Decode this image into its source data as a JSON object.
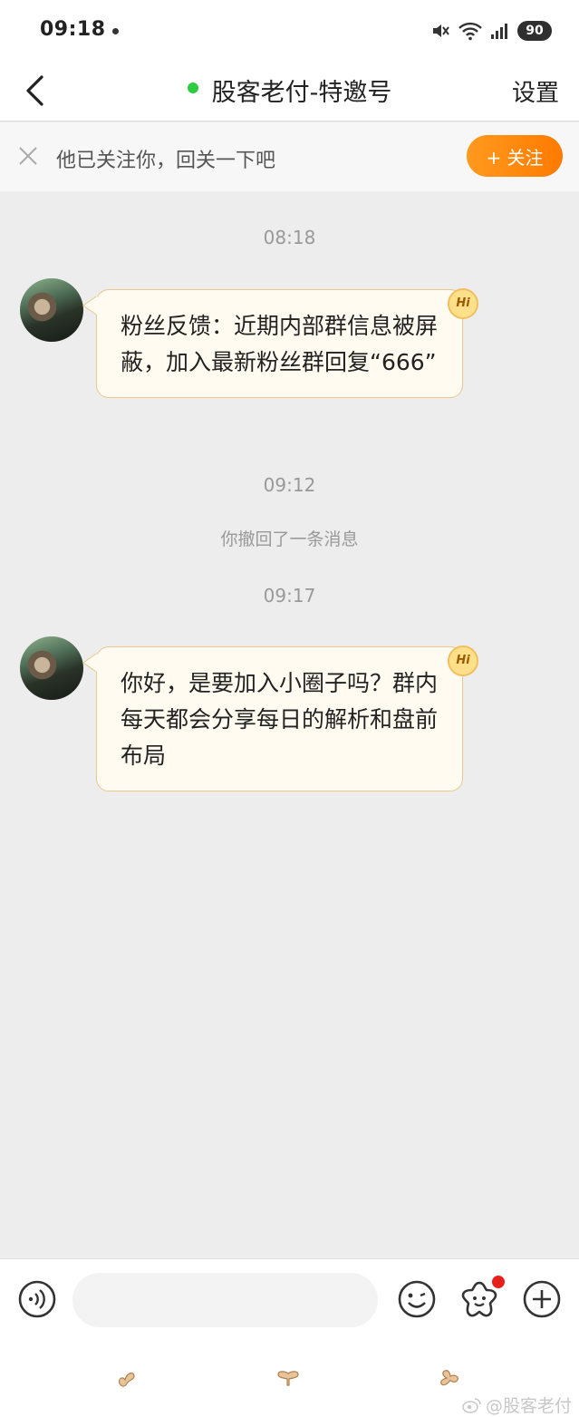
{
  "status_bar": {
    "time": "09:18",
    "battery": "90"
  },
  "nav": {
    "title": "股客老付-特邀号",
    "settings_label": "设置",
    "online_color": "#2ecc40"
  },
  "banner": {
    "text": "他已关注你，回关一下吧",
    "follow_label": "+ 关注",
    "accent": "#ff8a10"
  },
  "messages": [
    {
      "type": "timestamp",
      "text": "08:18"
    },
    {
      "type": "bubble",
      "text": "粉丝反馈：近期内部群信息被屏蔽，加入最新粉丝群回复“666”",
      "badge": "Hi"
    },
    {
      "type": "timestamp",
      "text": "09:12"
    },
    {
      "type": "system",
      "text": "你撤回了一条消息"
    },
    {
      "type": "timestamp",
      "text": "09:17"
    },
    {
      "type": "bubble",
      "text": "你好，是要加入小圈子吗？群内每天都会分享每日的解析和盘前布局",
      "badge": "Hi"
    }
  ],
  "input": {
    "placeholder": ""
  },
  "watermark": "@股客老付"
}
